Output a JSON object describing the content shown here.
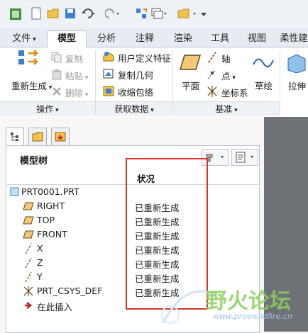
{
  "ribbon_tabs": [
    "文件",
    "模型",
    "分析",
    "注释",
    "渲染",
    "工具",
    "视图",
    "柔性建"
  ],
  "active_tab": "模型",
  "operations": {
    "regenerate": "重新生成",
    "copy": "复制",
    "paste": "粘贴",
    "delete": "删除",
    "group_label": "操作"
  },
  "get_data": {
    "udf": "用户定义特征",
    "copy_geometry": "复制几何",
    "shrinkwrap": "收缩包络",
    "group_label": "获取数据"
  },
  "datum": {
    "plane": "平面",
    "axis": "轴",
    "point": "点",
    "csys": "坐标系",
    "sketch": "草绘",
    "extrude": "拉伸",
    "group_label": "基准"
  },
  "model_tree": {
    "title": "模型树",
    "status_header": "状况",
    "root": "PRT0001.PRT",
    "items": [
      {
        "label": "RIGHT",
        "status": "已重新生成",
        "icon": "datum-plane-icon"
      },
      {
        "label": "TOP",
        "status": "已重新生成",
        "icon": "datum-plane-icon"
      },
      {
        "label": "FRONT",
        "status": "已重新生成",
        "icon": "datum-plane-icon"
      },
      {
        "label": "X",
        "status": "已重新生成",
        "icon": "datum-axis-icon"
      },
      {
        "label": "Z",
        "status": "已重新生成",
        "icon": "datum-axis-icon"
      },
      {
        "label": "Y",
        "status": "已重新生成",
        "icon": "datum-axis-icon"
      },
      {
        "label": "PRT_CSYS_DEF",
        "status": "已重新生成",
        "icon": "csys-icon"
      }
    ],
    "insert_here": "在此插入"
  },
  "watermark": {
    "text": "野火论坛",
    "url": "www.proewildfire.cn"
  },
  "colors": {
    "highlight_box": "#d9302c",
    "watermark": "#8ecf5f"
  }
}
